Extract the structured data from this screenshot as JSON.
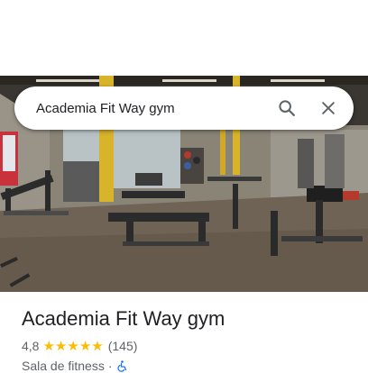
{
  "search": {
    "query": "Academia Fit Way gym",
    "search_icon": "search-icon",
    "close_icon": "close-icon"
  },
  "place": {
    "name": "Academia Fit Way gym",
    "rating": "4,8",
    "rating_fraction": 0.96,
    "reviews": "(145)",
    "category": "Sala de fitness",
    "separator": "·",
    "accessibility_icon": "wheelchair-accessible-icon"
  },
  "colors": {
    "star": "#fbbc04",
    "accessibility": "#1a73e8",
    "text_primary": "#202124",
    "text_secondary": "#5f6368"
  }
}
